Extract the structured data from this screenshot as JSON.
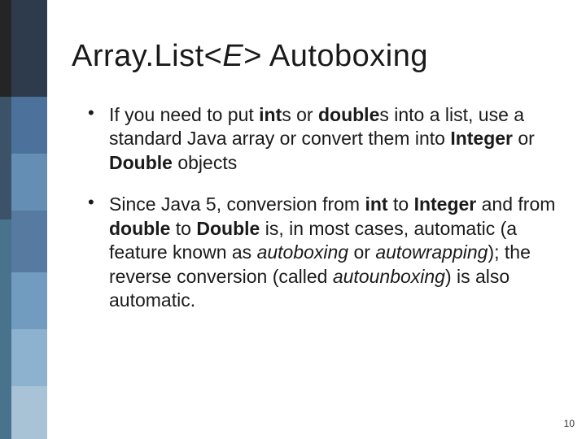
{
  "title": {
    "pre": "Array.List<",
    "em": "E",
    "post": "> Autoboxing"
  },
  "bullets": [
    {
      "segments": [
        {
          "t": "If you need to put "
        },
        {
          "t": "int",
          "b": true
        },
        {
          "t": "s or "
        },
        {
          "t": "double",
          "b": true
        },
        {
          "t": "s into a list, use a standard Java array or convert them into "
        },
        {
          "t": "Integer",
          "b": true
        },
        {
          "t": " or "
        },
        {
          "t": "Double",
          "b": true
        },
        {
          "t": " objects"
        }
      ]
    },
    {
      "segments": [
        {
          "t": "Since Java 5, conversion from "
        },
        {
          "t": "int",
          "b": true
        },
        {
          "t": " to "
        },
        {
          "t": "Integer",
          "b": true
        },
        {
          "t": " and from "
        },
        {
          "t": "double",
          "b": true
        },
        {
          "t": " to "
        },
        {
          "t": "Double",
          "b": true
        },
        {
          "t": " is, in most cases, automatic (a feature known as "
        },
        {
          "t": "autoboxing",
          "i": true
        },
        {
          "t": " or "
        },
        {
          "t": "autowrapping",
          "i": true
        },
        {
          "t": "); the reverse conversion (called "
        },
        {
          "t": "autounboxing",
          "i": true
        },
        {
          "t": ") is also automatic."
        }
      ]
    }
  ],
  "page_number": "10"
}
